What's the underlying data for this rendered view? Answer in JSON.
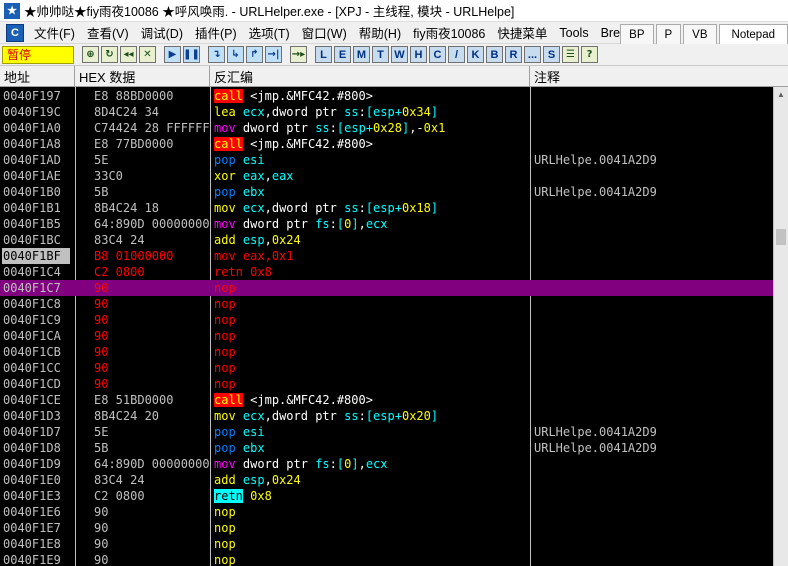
{
  "titlebar": {
    "title": "★帅帅哒★fiy雨夜10086  ★呼风唤雨. - URLHelper.exe - [XPJ - 主线程, 模块 - URLHelpe]"
  },
  "menu": {
    "items": [
      "文件(F)",
      "查看(V)",
      "调试(D)",
      "插件(P)",
      "选项(T)",
      "窗口(W)",
      "帮助(H)",
      "fiy雨夜10086",
      "快捷菜单",
      "Tools",
      "Bre"
    ],
    "tabs": [
      "BP",
      "P",
      "VB",
      "Notepad"
    ]
  },
  "toolbar": {
    "state": "暂停",
    "buttons": [
      "⊕",
      "↻",
      "◂◂",
      "✕",
      "▶",
      "❚❚",
      "↴",
      "↳",
      "↱",
      "→|",
      "→▸"
    ],
    "letters": [
      "L",
      "E",
      "M",
      "T",
      "W",
      "H",
      "C",
      "/",
      "K",
      "B",
      "R",
      "...",
      "S",
      "☰",
      "?"
    ]
  },
  "columns": {
    "addr": "地址",
    "hex": "HEX 数据",
    "dis": "反汇编",
    "com": "注释"
  },
  "rows": [
    {
      "addr": "0040F197",
      "hex": "E8 88BD0000",
      "mn": "call",
      "ops": "<jmp.&MFC42.#800>",
      "com": ""
    },
    {
      "addr": "0040F19C",
      "hex": "8D4C24 34",
      "mn": "lea",
      "ops": "ecx,dword ptr ss:[esp+0x34]",
      "com": ""
    },
    {
      "addr": "0040F1A0",
      "hex": "C74424 28 FFFFFFFF",
      "mn": "mov",
      "ops": "dword ptr ss:[esp+0x28],-0x1",
      "com": ""
    },
    {
      "addr": "0040F1A8",
      "hex": "E8 77BD0000",
      "mn": "call",
      "ops": "<jmp.&MFC42.#800>",
      "com": ""
    },
    {
      "addr": "0040F1AD",
      "hex": "5E",
      "mn": "pop",
      "ops": "esi",
      "com": "URLHelpe.0041A2D9"
    },
    {
      "addr": "0040F1AE",
      "hex": "33C0",
      "mn": "xor",
      "ops": "eax,eax",
      "com": ""
    },
    {
      "addr": "0040F1B0",
      "hex": "5B",
      "mn": "pop",
      "ops": "ebx",
      "com": "URLHelpe.0041A2D9"
    },
    {
      "addr": "0040F1B1",
      "hex": "8B4C24 18",
      "mn": "mov",
      "ops": "ecx,dword ptr ss:[esp+0x18]",
      "com": ""
    },
    {
      "addr": "0040F1B5",
      "hex": "64:890D 00000000",
      "mn": "mov",
      "ops": "dword ptr fs:[0],ecx",
      "com": ""
    },
    {
      "addr": "0040F1BC",
      "hex": "83C4 24",
      "mn": "add",
      "ops": "esp,0x24",
      "com": ""
    },
    {
      "addr": "0040F1BF",
      "hex": "B8 01000000",
      "mn": "mov",
      "ops": "eax,0x1",
      "com": ""
    },
    {
      "addr": "0040F1C4",
      "hex": "C2 0800",
      "mn": "retn",
      "ops": "0x8",
      "com": ""
    },
    {
      "addr": "0040F1C7",
      "hex": "90",
      "mn": "nop",
      "ops": "",
      "com": ""
    },
    {
      "addr": "0040F1C8",
      "hex": "90",
      "mn": "nop",
      "ops": "",
      "com": ""
    },
    {
      "addr": "0040F1C9",
      "hex": "90",
      "mn": "nop",
      "ops": "",
      "com": ""
    },
    {
      "addr": "0040F1CA",
      "hex": "90",
      "mn": "nop",
      "ops": "",
      "com": ""
    },
    {
      "addr": "0040F1CB",
      "hex": "90",
      "mn": "nop",
      "ops": "",
      "com": ""
    },
    {
      "addr": "0040F1CC",
      "hex": "90",
      "mn": "nop",
      "ops": "",
      "com": ""
    },
    {
      "addr": "0040F1CD",
      "hex": "90",
      "mn": "nop",
      "ops": "",
      "com": ""
    },
    {
      "addr": "0040F1CE",
      "hex": "E8 51BD0000",
      "mn": "call",
      "ops": "<jmp.&MFC42.#800>",
      "com": ""
    },
    {
      "addr": "0040F1D3",
      "hex": "8B4C24 20",
      "mn": "mov",
      "ops": "ecx,dword ptr ss:[esp+0x20]",
      "com": ""
    },
    {
      "addr": "0040F1D7",
      "hex": "5E",
      "mn": "pop",
      "ops": "esi",
      "com": "URLHelpe.0041A2D9"
    },
    {
      "addr": "0040F1D8",
      "hex": "5B",
      "mn": "pop",
      "ops": "ebx",
      "com": "URLHelpe.0041A2D9"
    },
    {
      "addr": "0040F1D9",
      "hex": "64:890D 00000000",
      "mn": "mov",
      "ops": "dword ptr fs:[0],ecx",
      "com": ""
    },
    {
      "addr": "0040F1E0",
      "hex": "83C4 24",
      "mn": "add",
      "ops": "esp,0x24",
      "com": ""
    },
    {
      "addr": "0040F1E3",
      "hex": "C2 0800",
      "mn": "retn",
      "ops": "0x8",
      "com": ""
    },
    {
      "addr": "0040F1E6",
      "hex": "90",
      "mn": "nop",
      "ops": "",
      "com": ""
    },
    {
      "addr": "0040F1E7",
      "hex": "90",
      "mn": "nop",
      "ops": "",
      "com": ""
    },
    {
      "addr": "0040F1E8",
      "hex": "90",
      "mn": "nop",
      "ops": "",
      "com": ""
    },
    {
      "addr": "0040F1E9",
      "hex": "90",
      "mn": "nop",
      "ops": "",
      "com": ""
    }
  ],
  "selected_row": "0040F1BF",
  "highlighted_row": "0040F1C7",
  "modified_rows": [
    "0040F1BF",
    "0040F1C4",
    "0040F1C7",
    "0040F1C8",
    "0040F1C9",
    "0040F1CA",
    "0040F1CB",
    "0040F1CC",
    "0040F1CD"
  ],
  "colors": {
    "background": "#000000",
    "highlight": "#800080",
    "modified": "#ff0000",
    "call_bg": "#ff0000",
    "retn_bg": "#00ffff",
    "state_bg": "#ffff00"
  }
}
